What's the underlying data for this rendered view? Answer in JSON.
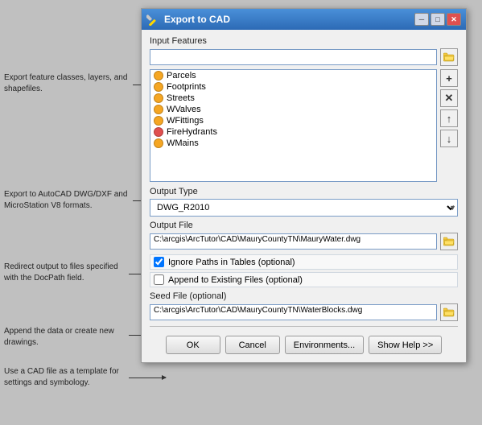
{
  "dialog": {
    "title": "Export to CAD",
    "window_controls": {
      "minimize": "─",
      "restore": "□",
      "close": "✕"
    }
  },
  "sections": {
    "input_features_label": "Input Features",
    "input_features_value": "",
    "list_items": [
      {
        "name": "Parcels",
        "color": "#f5a623"
      },
      {
        "name": "Footprints",
        "color": "#f5a623"
      },
      {
        "name": "Streets",
        "color": "#f5a623"
      },
      {
        "name": "WValves",
        "color": "#f5a623"
      },
      {
        "name": "WFittings",
        "color": "#f5a623"
      },
      {
        "name": "FireHydrants",
        "color": "#e05050"
      },
      {
        "name": "WMains",
        "color": "#f5a623"
      }
    ],
    "output_type_label": "Output Type",
    "output_type_value": "DWG_R2010",
    "output_file_label": "Output File",
    "output_file_value": "C:\\arcgis\\ArcTutor\\CAD\\MauryCountyTN\\MauryWater.dwg",
    "ignore_paths_label": "Ignore Paths in Tables (optional)",
    "ignore_paths_checked": true,
    "append_label": "Append to Existing Files (optional)",
    "append_checked": false,
    "seed_file_label": "Seed File (optional)",
    "seed_file_value": "C:\\arcgis\\ArcTutor\\CAD\\MauryCountyTN\\WaterBlocks.dwg"
  },
  "buttons": {
    "ok": "OK",
    "cancel": "Cancel",
    "environments": "Environments...",
    "show_help": "Show Help >>"
  },
  "annotations": [
    {
      "id": "ann1",
      "text": "Export feature classes, layers, and shapefiles."
    },
    {
      "id": "ann2",
      "text": "Export to AutoCAD DWG/DXF and MicroStation V8 formats."
    },
    {
      "id": "ann3",
      "text": "Redirect output to files specified with the DocPath field."
    },
    {
      "id": "ann4",
      "text": "Append the data or create new drawings."
    },
    {
      "id": "ann5",
      "text": "Use a CAD file as a template for settings and symbology."
    }
  ],
  "side_buttons": {
    "add": "+",
    "remove": "✕",
    "up": "↑",
    "down": "↓"
  }
}
